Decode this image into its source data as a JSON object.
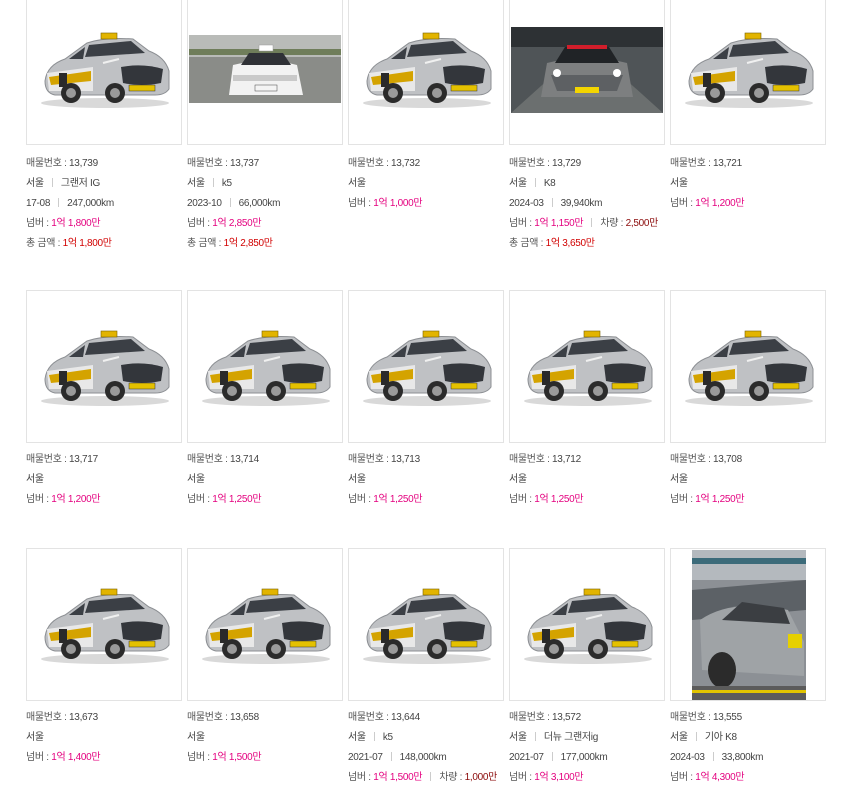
{
  "labels": {
    "listing_no": "매물번호 : ",
    "license_price": "넘버 : ",
    "vehicle_price": "차량 : ",
    "total_price": "총 금액 : "
  },
  "colors": {
    "price_pink": "#e4007f",
    "total_red": "#d10000",
    "vehicle_maroon": "#8b0a0a"
  },
  "listings": [
    {
      "no": "13,739",
      "region": "서울",
      "model": "그랜저 IG",
      "date": "17-08",
      "mileage": "247,000km",
      "license_price": "1억 1,800만",
      "total_price": "1억 1,800만",
      "image": "taxi-sonata-icon"
    },
    {
      "no": "13,737",
      "region": "서울",
      "model": "k5",
      "date": "2023-10",
      "mileage": "66,000km",
      "license_price": "1억 2,850만",
      "total_price": "1억 2,850만",
      "image": "white-k5-photo"
    },
    {
      "no": "13,732",
      "region": "서울",
      "license_price": "1억 1,000만",
      "image": "taxi-sonata-icon"
    },
    {
      "no": "13,729",
      "region": "서울",
      "model": "K8",
      "date": "2024-03",
      "mileage": "39,940km",
      "license_price": "1억 1,150만",
      "vehicle_price": "2,500만",
      "total_price": "1억 3,650만",
      "image": "grey-k8-garage-photo"
    },
    {
      "no": "13,721",
      "region": "서울",
      "license_price": "1억 1,200만",
      "image": "taxi-sonata-icon"
    },
    {
      "no": "13,717",
      "region": "서울",
      "license_price": "1억 1,200만",
      "image": "taxi-sonata-icon"
    },
    {
      "no": "13,714",
      "region": "서울",
      "license_price": "1억 1,250만",
      "image": "taxi-sonata-icon"
    },
    {
      "no": "13,713",
      "region": "서울",
      "license_price": "1억 1,250만",
      "image": "taxi-sonata-icon"
    },
    {
      "no": "13,712",
      "region": "서울",
      "license_price": "1억 1,250만",
      "image": "taxi-sonata-icon"
    },
    {
      "no": "13,708",
      "region": "서울",
      "license_price": "1억 1,250만",
      "image": "taxi-sonata-icon"
    },
    {
      "no": "13,673",
      "region": "서울",
      "license_price": "1억 1,400만",
      "image": "taxi-sonata-icon"
    },
    {
      "no": "13,658",
      "region": "서울",
      "license_price": "1억 1,500만",
      "image": "taxi-sonata-icon"
    },
    {
      "no": "13,644",
      "region": "서울",
      "model": "k5",
      "date": "2021-07",
      "mileage": "148,000km",
      "license_price": "1억 1,500만",
      "vehicle_price": "1,000만",
      "image": "taxi-sonata-icon"
    },
    {
      "no": "13,572",
      "region": "서울",
      "model": "더뉴 그랜저ig",
      "date": "2021-07",
      "mileage": "177,000km",
      "license_price": "1억 3,100만",
      "image": "taxi-sonata-icon"
    },
    {
      "no": "13,555",
      "region": "서울",
      "model": "기아 K8",
      "date": "2024-03",
      "mileage": "33,800km",
      "license_price": "1억 4,300만",
      "image": "grey-k8-rain-photo"
    }
  ]
}
